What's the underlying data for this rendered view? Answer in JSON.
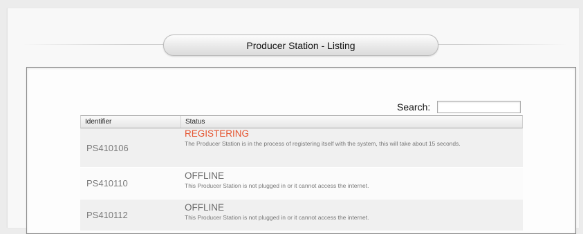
{
  "header": {
    "title": "Producer Station - Listing"
  },
  "search": {
    "label": "Search:",
    "value": "",
    "placeholder": ""
  },
  "table": {
    "columns": [
      "Identifier",
      "Status"
    ],
    "rows": [
      {
        "identifier": "PS410106",
        "status": "REGISTERING",
        "status_color": "#e5532e",
        "description": "The Producer Station is in the process of registering itself with the system, this will take about 15 seconds."
      },
      {
        "identifier": "PS410110",
        "status": "OFFLINE",
        "status_color": "#6a6a6a",
        "description": "This Producer Station is not plugged in or it cannot access the internet."
      },
      {
        "identifier": "PS410112",
        "status": "OFFLINE",
        "status_color": "#6a6a6a",
        "description": "This Producer Station is not plugged in or it cannot access the internet."
      }
    ]
  }
}
